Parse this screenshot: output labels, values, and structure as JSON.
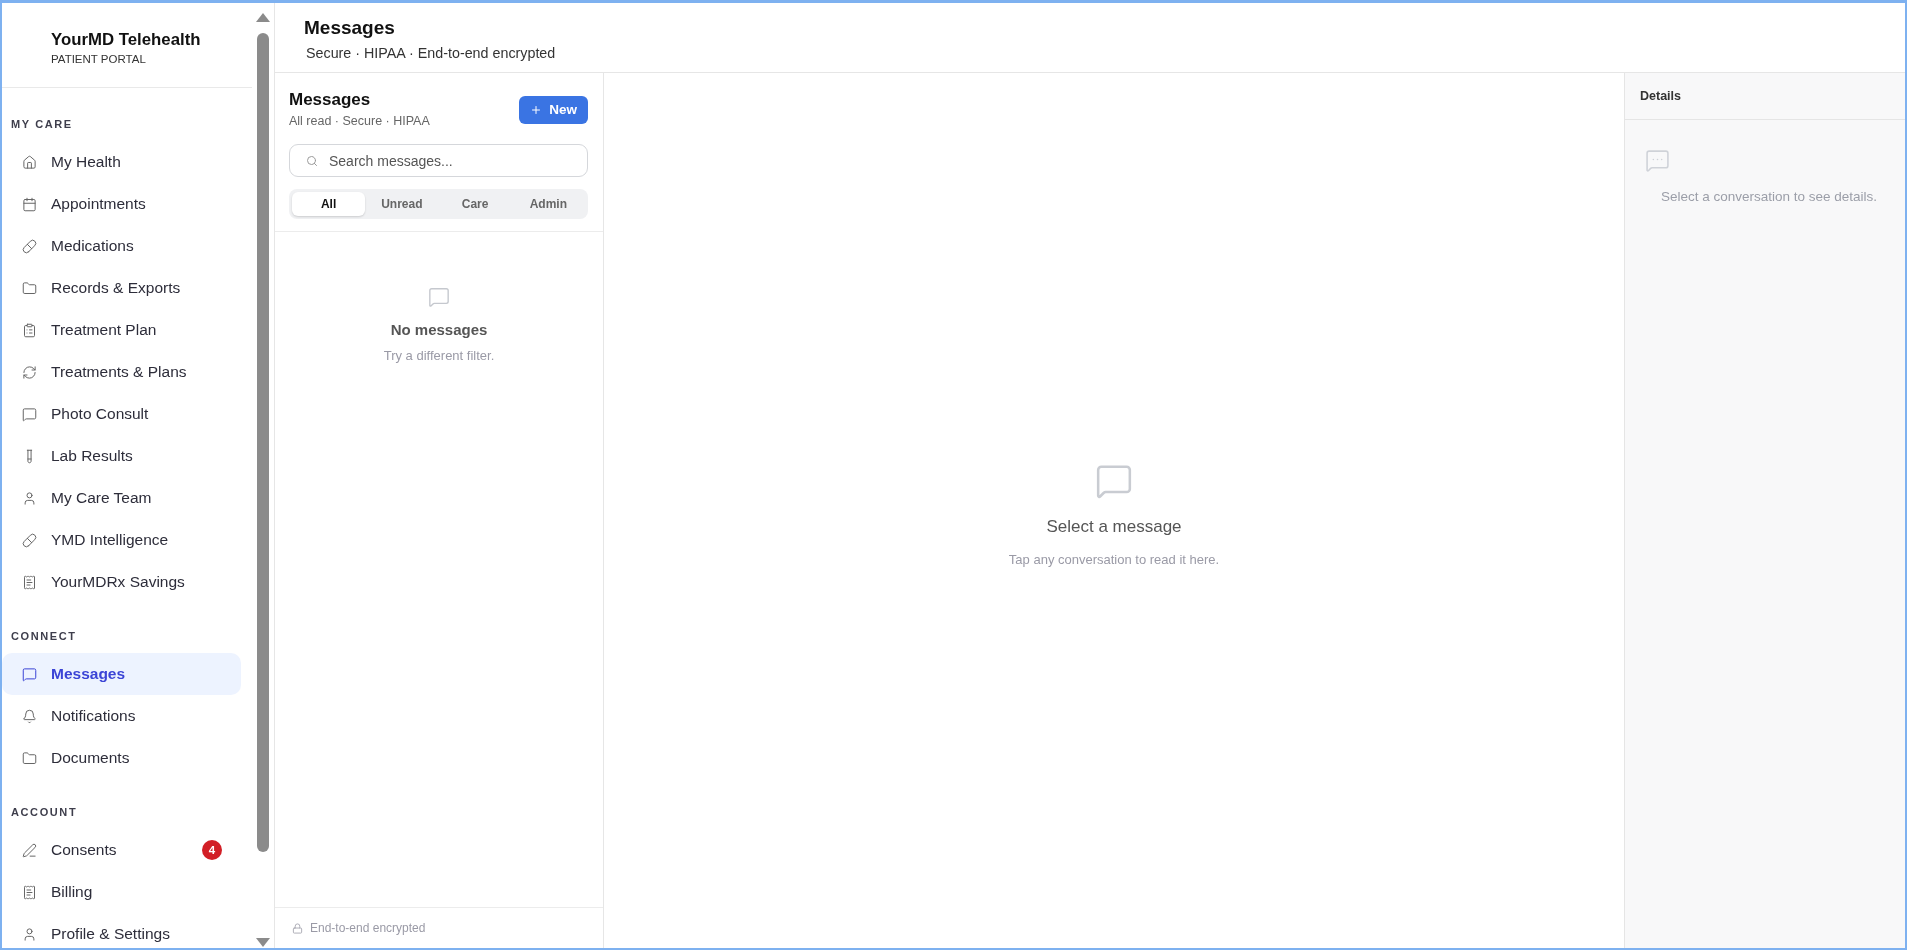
{
  "sidebar": {
    "brand": {
      "name": "YourMD Telehealth",
      "tagline": "PATIENT PORTAL"
    },
    "sections": [
      {
        "title": "MY CARE",
        "items": [
          {
            "label": "My Health",
            "kind": "home",
            "selected": false
          },
          {
            "label": "Appointments",
            "kind": "calendar",
            "selected": false
          },
          {
            "label": "Medications",
            "kind": "pill",
            "selected": false
          },
          {
            "label": "Records & Exports",
            "kind": "folder",
            "selected": false
          },
          {
            "label": "Treatment Plan",
            "kind": "clipboard",
            "selected": false
          },
          {
            "label": "Treatments & Plans",
            "kind": "refresh",
            "selected": false
          },
          {
            "label": "Photo Consult",
            "kind": "chat",
            "selected": false
          },
          {
            "label": "Lab Results",
            "kind": "tube",
            "selected": false
          },
          {
            "label": "My Care Team",
            "kind": "person",
            "selected": false
          },
          {
            "label": "YMD Intelligence",
            "kind": "pill",
            "selected": false
          },
          {
            "label": "YourMDRx Savings",
            "kind": "receipt",
            "selected": false
          }
        ]
      },
      {
        "title": "CONNECT",
        "items": [
          {
            "label": "Messages",
            "kind": "chat",
            "selected": true
          },
          {
            "label": "Notifications",
            "kind": "bell",
            "selected": false
          },
          {
            "label": "Documents",
            "kind": "folder",
            "selected": false
          }
        ]
      },
      {
        "title": "ACCOUNT",
        "items": [
          {
            "label": "Consents",
            "kind": "pen",
            "selected": false,
            "badge": "4"
          },
          {
            "label": "Billing",
            "kind": "receipt",
            "selected": false
          },
          {
            "label": "Profile & Settings",
            "kind": "person",
            "selected": false
          }
        ]
      }
    ]
  },
  "header": {
    "title": "Messages",
    "subtitle": "Secure · HIPAA · End-to-end encrypted"
  },
  "message_list": {
    "title": "Messages",
    "subtitle": "All read · Secure · HIPAA",
    "new_button": {
      "label": "New"
    },
    "search": {
      "placeholder": "Search messages..."
    },
    "filters": [
      {
        "label": "All",
        "selected": true
      },
      {
        "label": "Unread",
        "selected": false
      },
      {
        "label": "Care",
        "selected": false
      },
      {
        "label": "Admin",
        "selected": false
      }
    ],
    "empty_state": {
      "title": "No messages",
      "hint": "Try a different filter."
    },
    "footer": {
      "text": "End-to-end encrypted"
    }
  },
  "conversation": {
    "empty_state": {
      "title": "Select a message",
      "hint": "Tap any conversation to read it here."
    }
  },
  "details": {
    "title": "Details",
    "empty_state": {
      "hint": "Select a conversation to see details."
    }
  }
}
